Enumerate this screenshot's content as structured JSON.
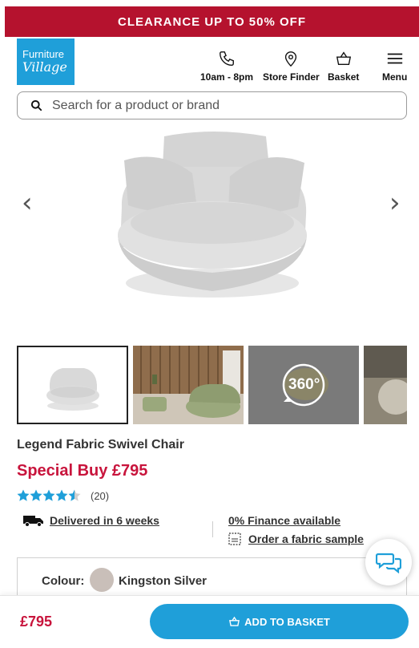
{
  "promo": {
    "text": "CLEARANCE UP TO 50% OFF"
  },
  "logo": {
    "line1": "Furniture",
    "line2": "Village"
  },
  "header": {
    "hours_label": "10am - 8pm",
    "store_finder_label": "Store Finder",
    "basket_label": "Basket",
    "menu_label": "Menu"
  },
  "search": {
    "placeholder": "Search for a product or brand"
  },
  "gallery": {
    "prev_icon": "‹",
    "next_icon": "›",
    "thumb_360_label": "360°"
  },
  "product": {
    "title": "Legend Fabric Swivel Chair",
    "special_price": "Special Buy £795",
    "rating": 4.5,
    "rating_count": "(20)"
  },
  "delivery": {
    "text": "Delivered in 6 weeks"
  },
  "finance": {
    "text": "0% Finance available"
  },
  "sample": {
    "text": "Order a fabric sample"
  },
  "colour": {
    "label": "Colour:",
    "name": "Kingston Silver",
    "swatch": "#c9bfb9"
  },
  "footer": {
    "price": "£795",
    "add_label": "ADD TO BASKET"
  },
  "colors": {
    "brand_blue": "#1f9fd9",
    "promo_red": "#b5122e",
    "price_red": "#c8143c",
    "star_blue": "#1f9fd9"
  }
}
